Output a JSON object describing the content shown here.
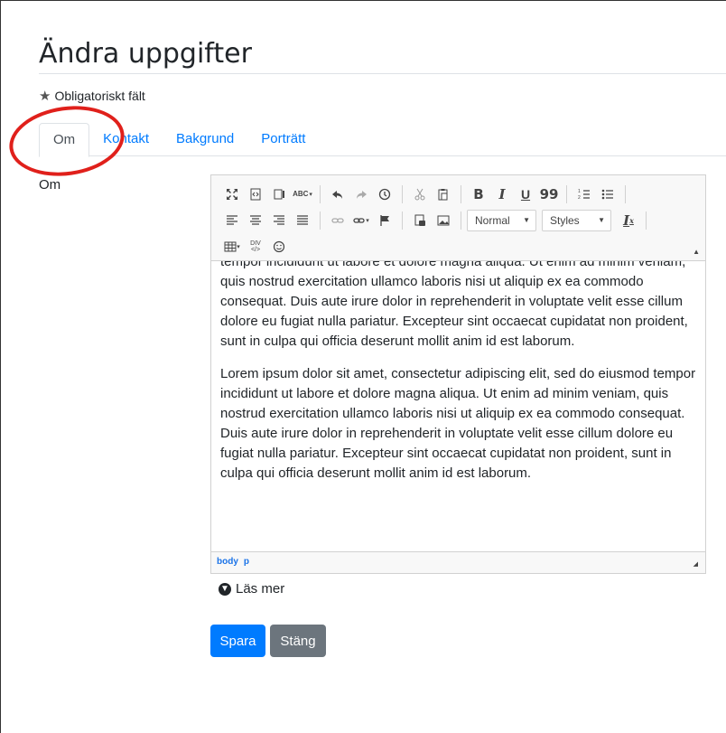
{
  "page": {
    "title": "Ändra uppgifter",
    "required_note": "Obligatoriskt fält"
  },
  "tabs": [
    {
      "label": "Om",
      "active": true
    },
    {
      "label": "Kontakt",
      "active": false
    },
    {
      "label": "Bakgrund",
      "active": false
    },
    {
      "label": "Porträtt",
      "active": false
    }
  ],
  "annotation": {
    "shape": "ellipse",
    "color": "#e0201b",
    "target": "tab-om"
  },
  "form": {
    "field_label": "Om",
    "editor": {
      "toolbar": {
        "row1_icons": [
          "maximize-icon",
          "source-icon",
          "preview-icon",
          "spellcheck-icon",
          "undo-icon",
          "redo-icon",
          "history-icon",
          "cut-icon",
          "paste-icon",
          "bold-icon",
          "italic-icon",
          "underline-icon",
          "blockquote-icon",
          "numbered-list-icon",
          "bulleted-list-icon"
        ],
        "row2_icons": [
          "align-left-icon",
          "align-center-icon",
          "align-right-icon",
          "justify-icon",
          "unlink-icon",
          "link-icon",
          "anchor-icon",
          "document-icon",
          "image-icon",
          "remove-format-icon"
        ],
        "row3_icons": [
          "table-icon",
          "div-icon",
          "emoji-icon"
        ],
        "bold": "B",
        "italic": "I",
        "underline": "U",
        "blockquote": "99",
        "format_select": "Normal",
        "styles_select": "Styles",
        "div_label": "DIV"
      },
      "paragraphs": [
        "tempor incididunt ut labore et dolore magna aliqua. Ut enim ad minim veniam, quis nostrud exercitation ullamco laboris nisi ut aliquip ex ea commodo consequat. Duis aute irure dolor in reprehenderit in voluptate velit esse cillum dolore eu fugiat nulla pariatur. Excepteur sint occaecat cupidatat non proident, sunt in culpa qui officia deserunt mollit anim id est laborum.",
        "Lorem ipsum dolor sit amet, consectetur adipiscing elit, sed do eiusmod tempor incididunt ut labore et dolore magna aliqua. Ut enim ad minim veniam, quis nostrud exercitation ullamco laboris nisi ut aliquip ex ea commodo consequat. Duis aute irure dolor in reprehenderit in voluptate velit esse cillum dolore eu fugiat nulla pariatur. Excepteur sint occaecat cupidatat non proident, sunt in culpa qui officia deserunt mollit anim id est laborum."
      ],
      "statusbar": {
        "path1": "body",
        "path2": "p"
      }
    },
    "read_more": "Läs mer",
    "buttons": {
      "save": "Spara",
      "close": "Stäng"
    }
  },
  "colors": {
    "primary": "#007bff",
    "secondary": "#6c757d",
    "annotation": "#e0201b"
  }
}
